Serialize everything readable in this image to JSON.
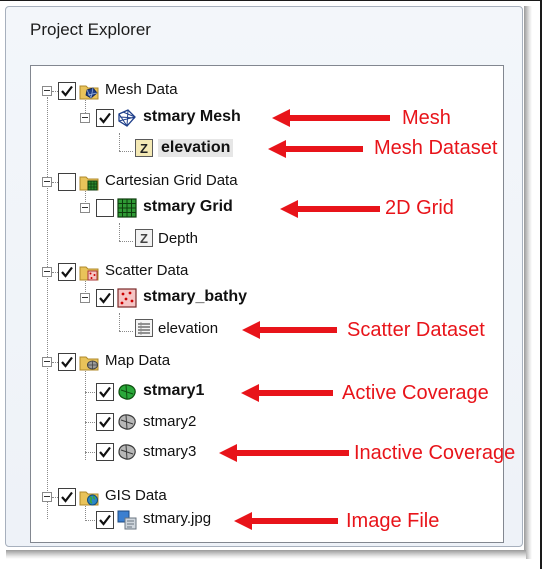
{
  "panel": {
    "title": "Project Explorer"
  },
  "tree": {
    "nodes": [
      {
        "label": "Mesh Data",
        "checked": true,
        "icon": "mesh-folder-icon"
      },
      {
        "label": "stmary Mesh",
        "checked": true,
        "icon": "mesh-icon"
      },
      {
        "label": "elevation",
        "icon": "z-dataset-icon"
      },
      {
        "label": "Cartesian Grid Data",
        "checked": false,
        "icon": "grid-folder-icon"
      },
      {
        "label": "stmary Grid",
        "checked": false,
        "icon": "grid-icon"
      },
      {
        "label": "Depth",
        "icon": "z-dataset-icon"
      },
      {
        "label": "Scatter Data",
        "checked": true,
        "icon": "scatter-folder-icon"
      },
      {
        "label": "stmary_bathy",
        "checked": true,
        "icon": "scatter-icon"
      },
      {
        "label": "elevation",
        "icon": "scatter-dataset-icon"
      },
      {
        "label": "Map Data",
        "checked": true,
        "icon": "map-folder-icon"
      },
      {
        "label": "stmary1",
        "checked": true,
        "icon": "active-coverage-icon"
      },
      {
        "label": "stmary2",
        "checked": true,
        "icon": "coverage-icon"
      },
      {
        "label": "stmary3",
        "checked": true,
        "icon": "coverage-icon"
      },
      {
        "label": "GIS Data",
        "checked": true,
        "icon": "gis-folder-icon"
      },
      {
        "label": "stmary.jpg",
        "checked": true,
        "icon": "image-file-icon"
      }
    ]
  },
  "annotations": {
    "mesh": "Mesh",
    "mesh_dataset": "Mesh Dataset",
    "grid_2d": "2D Grid",
    "scatter_dataset": "Scatter Dataset",
    "active_coverage": "Active Coverage",
    "inactive_coverage": "Inactive Coverage",
    "image_file": "Image File"
  },
  "colors": {
    "annotation_red": "#e8141a",
    "mesh_blue": "#1f3f8a",
    "grid_green": "#1d6b1d",
    "active_green": "#1a9a2a",
    "folder_yellow": "#e9c35a"
  }
}
